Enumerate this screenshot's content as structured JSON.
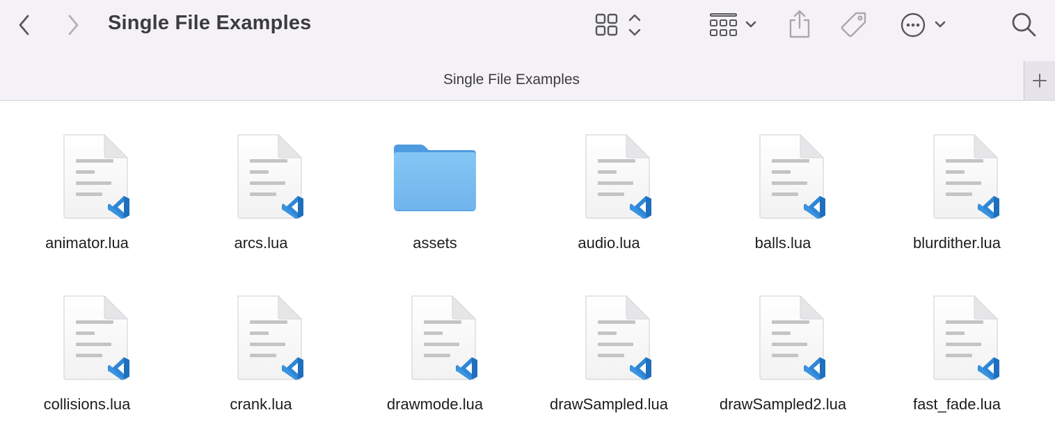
{
  "toolbar": {
    "title": "Single File Examples",
    "back_icon": "chevron-left-icon",
    "forward_icon": "chevron-right-icon",
    "view_icon": "grid-view-icon",
    "group_icon": "group-by-icon",
    "share_icon": "share-icon",
    "tag_icon": "tag-icon",
    "more_icon": "ellipsis-circle-icon",
    "search_icon": "search-icon"
  },
  "tabbar": {
    "tab_label": "Single File Examples",
    "new_tab_icon": "plus-icon"
  },
  "items": [
    {
      "label": "animator.lua",
      "kind": "lua-file"
    },
    {
      "label": "arcs.lua",
      "kind": "lua-file"
    },
    {
      "label": "assets",
      "kind": "folder"
    },
    {
      "label": "audio.lua",
      "kind": "lua-file"
    },
    {
      "label": "balls.lua",
      "kind": "lua-file"
    },
    {
      "label": "blurdither.lua",
      "kind": "lua-file"
    },
    {
      "label": "collisions.lua",
      "kind": "lua-file"
    },
    {
      "label": "crank.lua",
      "kind": "lua-file"
    },
    {
      "label": "drawmode.lua",
      "kind": "lua-file"
    },
    {
      "label": "drawSampled.lua",
      "kind": "lua-file"
    },
    {
      "label": "drawSampled2.lua",
      "kind": "lua-file"
    },
    {
      "label": "fast_fade.lua",
      "kind": "lua-file"
    }
  ],
  "colors": {
    "toolbar_bg": "#f4f2f6",
    "folder_blue": "#72b9f0",
    "vscode_blue": "#2e86d6"
  }
}
